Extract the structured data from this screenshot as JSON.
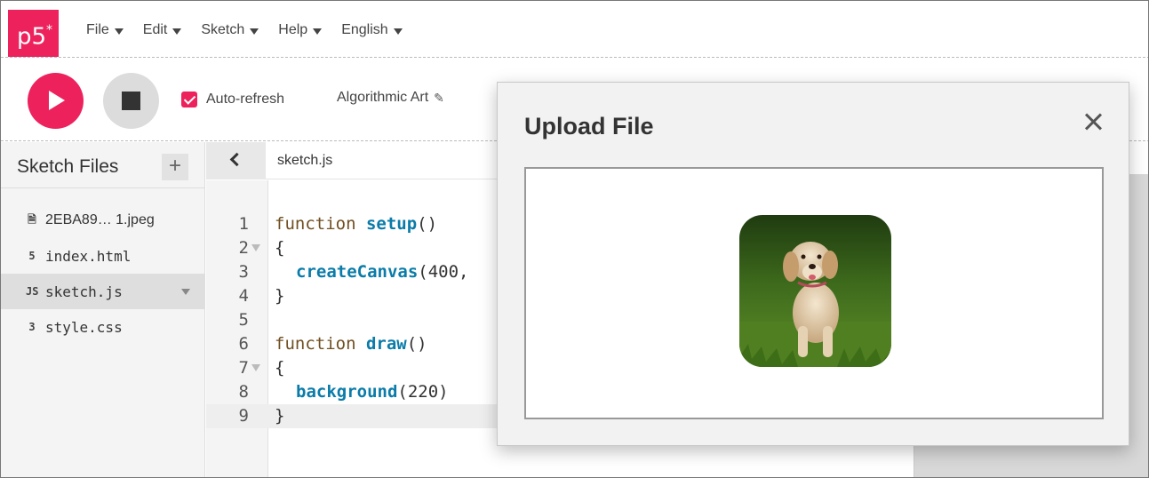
{
  "app": {
    "logo": "p5",
    "logo_sup": "*"
  },
  "menu": [
    {
      "label": "File"
    },
    {
      "label": "Edit"
    },
    {
      "label": "Sketch"
    },
    {
      "label": "Help"
    },
    {
      "label": "English"
    }
  ],
  "toolbar": {
    "auto_refresh_label": "Auto-refresh",
    "auto_refresh_checked": true,
    "sketch_name": "Algorithmic Art"
  },
  "sidebar": {
    "title": "Sketch Files",
    "add_label": "+",
    "files": [
      {
        "name": "2EBA89… 1.jpeg",
        "icon": "file-icon"
      },
      {
        "name": "index.html",
        "icon": "html-icon"
      },
      {
        "name": "sketch.js",
        "icon": "js-icon",
        "active": true
      },
      {
        "name": "style.css",
        "icon": "css-icon"
      }
    ]
  },
  "editor": {
    "tab_name": "sketch.js",
    "lines": [
      {
        "n": "1"
      },
      {
        "n": "2"
      },
      {
        "n": "3"
      },
      {
        "n": "4"
      },
      {
        "n": "5"
      },
      {
        "n": "6"
      },
      {
        "n": "7"
      },
      {
        "n": "8"
      },
      {
        "n": "9"
      }
    ],
    "code": {
      "l1_kw": "function ",
      "l1_fn": "setup",
      "l1_rest": "()",
      "l2": "{",
      "l3_fn": "createCanvas",
      "l3_rest": "(400,",
      "l4": "}",
      "l6_kw": "function ",
      "l6_fn": "draw",
      "l6_rest": "()",
      "l7": "{",
      "l8_fn": "background",
      "l8_rest": "(220)",
      "l9": "}"
    }
  },
  "modal": {
    "title": "Upload File"
  },
  "colors": {
    "accent": "#ed225d"
  }
}
